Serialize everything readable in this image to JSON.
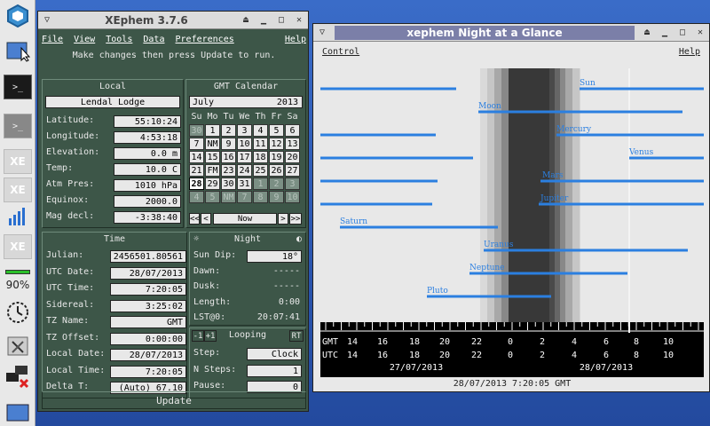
{
  "taskbar": {
    "terminal_glyph": ">_",
    "xe_label": "XE",
    "battery": "90%"
  },
  "main_window": {
    "title": "XEphem 3.7.6",
    "menu": [
      "File",
      "View",
      "Tools",
      "Data",
      "Preferences"
    ],
    "help": "Help",
    "hint": "Make changes then press Update to run.",
    "local": {
      "heading": "Local",
      "site": "Lendal Lodge",
      "rows": [
        {
          "label": "Latitude:",
          "value": "55:10:24"
        },
        {
          "label": "Longitude:",
          "value": "4:53:18"
        },
        {
          "label": "Elevation:",
          "value": "0.0 m"
        },
        {
          "label": "Temp:",
          "value": "10.0 C"
        },
        {
          "label": "Atm Pres:",
          "value": "1010 hPa"
        },
        {
          "label": "Equinox:",
          "value": "2000.0"
        },
        {
          "label": "Mag decl:",
          "value": "-3:38:40"
        }
      ]
    },
    "calendar": {
      "heading": "GMT Calendar",
      "month": "July",
      "year": "2013",
      "weekdays": [
        "Su",
        "Mo",
        "Tu",
        "We",
        "Th",
        "Fr",
        "Sa"
      ],
      "cells": [
        [
          "30",
          "1",
          "2",
          "3",
          "4",
          "5",
          "6"
        ],
        [
          "7",
          "NM",
          "9",
          "10",
          "11",
          "12",
          "13"
        ],
        [
          "14",
          "15",
          "16",
          "17",
          "18",
          "19",
          "20"
        ],
        [
          "21",
          "FM",
          "23",
          "24",
          "25",
          "26",
          "27"
        ],
        [
          "28",
          "29",
          "30",
          "31",
          "1",
          "2",
          "3"
        ],
        [
          "4",
          "5",
          "NM",
          "7",
          "8",
          "9",
          "10"
        ]
      ],
      "nav": [
        "<<",
        "<",
        "Now",
        ">",
        ">>"
      ]
    },
    "time": {
      "heading": "Time",
      "rows": [
        {
          "label": "Julian:",
          "value": "2456501.80561"
        },
        {
          "label": "UTC Date:",
          "value": "28/07/2013"
        },
        {
          "label": "UTC Time:",
          "value": "7:20:05"
        },
        {
          "label": "Sidereal:",
          "value": "3:25:02"
        },
        {
          "label": "TZ Name:",
          "value": "GMT"
        },
        {
          "label": "TZ Offset:",
          "value": "0:00:00"
        },
        {
          "label": "Local Date:",
          "value": "28/07/2013"
        },
        {
          "label": "Local Time:",
          "value": "7:20:05"
        },
        {
          "label": "Delta T:",
          "value": "(Auto)  67.10"
        }
      ]
    },
    "night": {
      "heading": "Night",
      "rows": [
        {
          "label": "Sun Dip:",
          "value": "18°"
        },
        {
          "label": "Dawn:",
          "value": "-----"
        },
        {
          "label": "Dusk:",
          "value": "-----"
        },
        {
          "label": "Length:",
          "value": "0:00"
        },
        {
          "label": "LST@0:",
          "value": "20:07:41"
        }
      ]
    },
    "looping": {
      "minus": "-1",
      "plus": "+1",
      "heading": "Looping",
      "rt": "RT",
      "rows": [
        {
          "label": "Step:",
          "value": "Clock"
        },
        {
          "label": "N Steps:",
          "value": "1"
        },
        {
          "label": "Pause:",
          "value": "0"
        }
      ]
    },
    "update": "Update"
  },
  "glance_window": {
    "title": "xephem Night at a Glance",
    "control": "Control",
    "help": "Help",
    "planets": [
      {
        "name": "Sun"
      },
      {
        "name": "Moon"
      },
      {
        "name": "Mercury"
      },
      {
        "name": "Venus"
      },
      {
        "name": "Mars"
      },
      {
        "name": "Jupiter"
      },
      {
        "name": "Saturn"
      },
      {
        "name": "Uranus"
      },
      {
        "name": "Neptune"
      },
      {
        "name": "Pluto"
      }
    ],
    "gmt_label": "GMT",
    "utc_label": "UTC",
    "hours": [
      "14",
      "16",
      "18",
      "20",
      "22",
      "0",
      "2",
      "4",
      "6",
      "8",
      "10"
    ],
    "date_left": "27/07/2013",
    "date_right": "28/07/2013",
    "status": "28/07/2013   7:20:05 GMT",
    "colors": {
      "bar": "#2b7fe0",
      "label": "#2b7fe0"
    }
  }
}
